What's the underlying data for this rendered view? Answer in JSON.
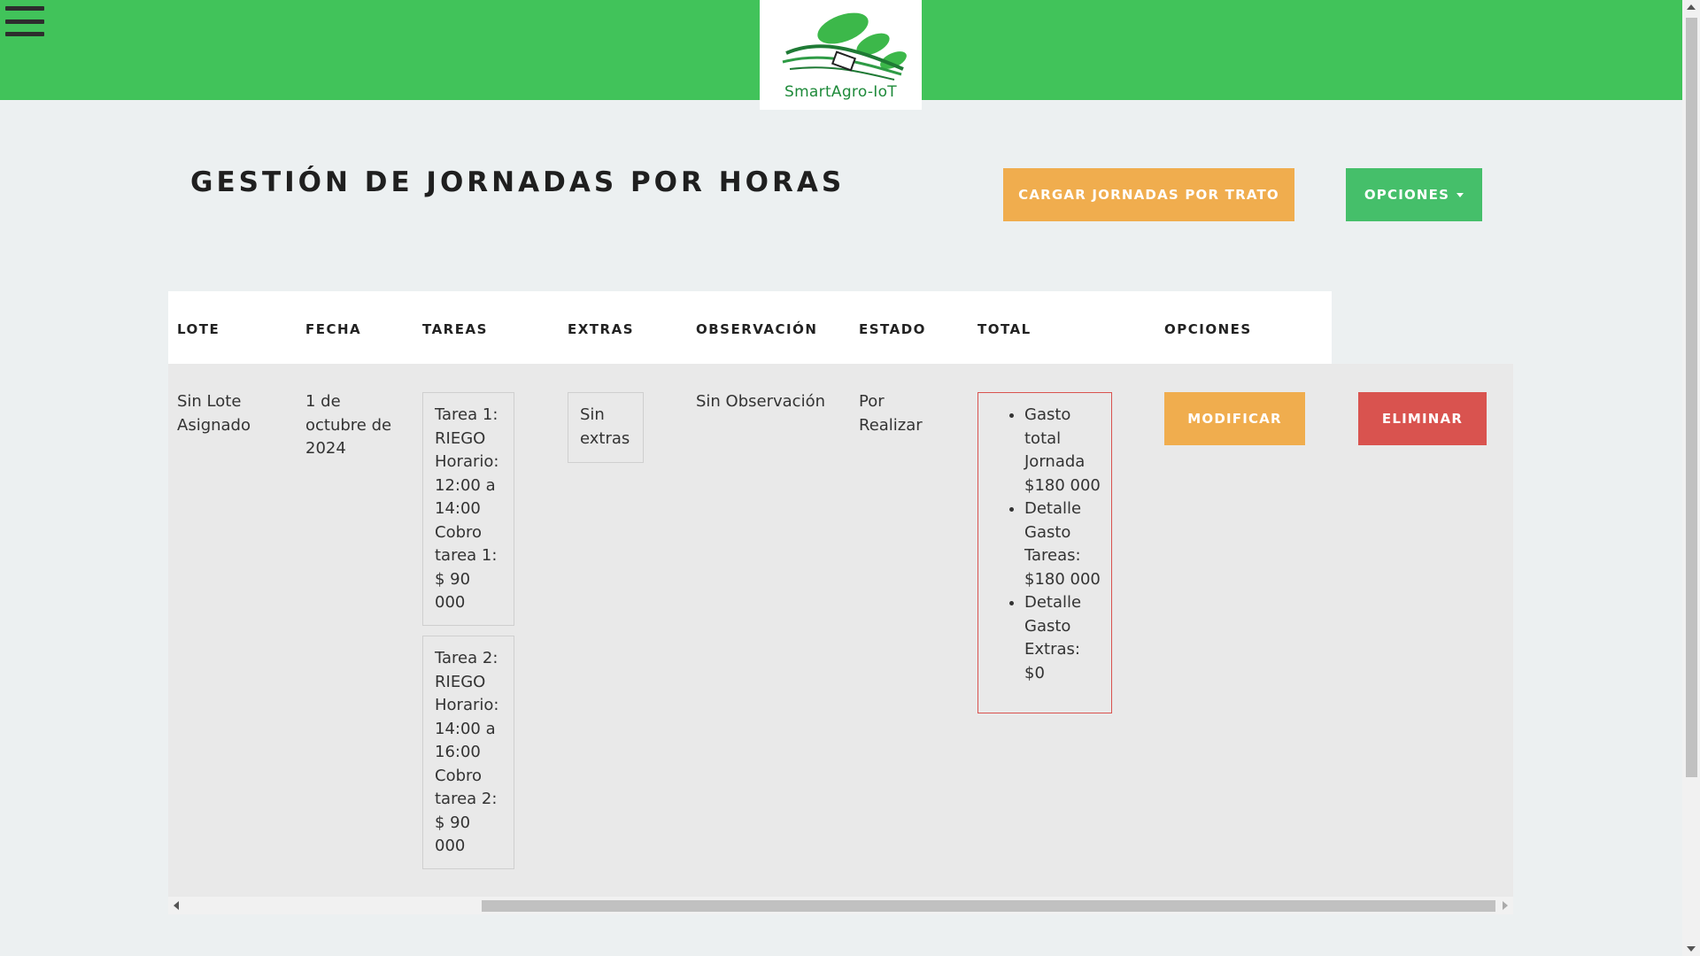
{
  "header": {
    "brand": "SmartAgro-IoT",
    "menu_icon": "hamburger-menu-icon",
    "colors": {
      "bar": "#41c35a",
      "brand_text": "#1e8a3a"
    }
  },
  "page": {
    "title": "GESTIÓN DE JORNADAS POR HORAS",
    "load_button": "CARGAR JORNADAS POR TRATO",
    "options_button": "OPCIONES",
    "colors": {
      "warning": "#f0ad4e",
      "success": "#45bf6a",
      "danger": "#d9534f"
    }
  },
  "table": {
    "headers": {
      "lote": "LOTE",
      "fecha": "FECHA",
      "tareas": "TAREAS",
      "extras": "EXTRAS",
      "observacion": "OBSERVACIÓN",
      "estado": "ESTADO",
      "total": "TOTAL",
      "opciones": "OPCIONES"
    },
    "row": {
      "lote": "Sin Lote Asignado",
      "fecha": "1 de octubre de 2024",
      "tareas": [
        "Tarea 1: RIEGO Horario: 12:00 a 14:00 Cobro tarea 1: $ 90 000",
        "Tarea 2: RIEGO Horario: 14:00 a 16:00 Cobro tarea 2: $ 90 000"
      ],
      "extras": "Sin extras",
      "observacion": "Sin Observación",
      "estado": "Por Realizar",
      "total": [
        "Gasto total Jornada $180 000",
        "Detalle Gasto Tareas: $180 000",
        "Detalle Gasto Extras: $0"
      ],
      "modify_button": "MODIFICAR",
      "delete_button": "ELIMINAR"
    }
  }
}
